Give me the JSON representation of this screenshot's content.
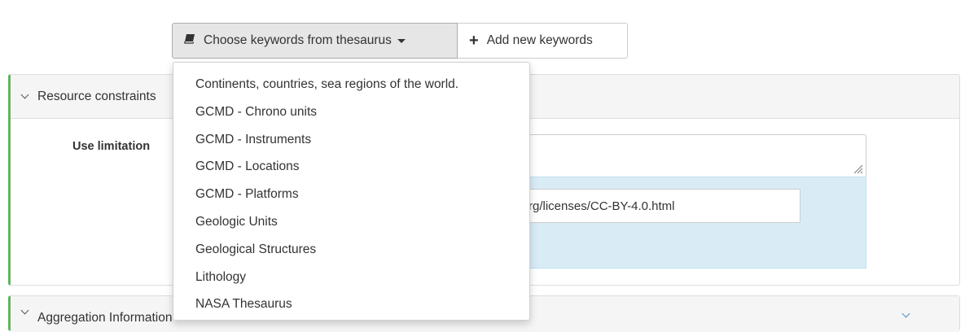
{
  "toolbar": {
    "thesaurus_button": "Choose keywords from thesaurus",
    "add_button": "Add new keywords"
  },
  "dropdown": {
    "items": [
      "Continents, countries, sea regions of the world.",
      "GCMD - Chrono units",
      "GCMD - Instruments",
      "GCMD - Locations",
      "GCMD - Platforms",
      "Geologic Units",
      "Geological Structures",
      "Lithology",
      "NASA Thesaurus"
    ]
  },
  "panels": {
    "resource_constraints": {
      "title": "Resource constraints",
      "use_limitation_label": "Use limitation",
      "license_url": "rg/licenses/CC-BY-4.0.html"
    },
    "aggregation": {
      "title": "Aggregation Information"
    }
  },
  "icons": {
    "book": "book-icon",
    "plus": "plus-icon",
    "chevron": "chevron-down-icon"
  },
  "colors": {
    "panel_accent": "#5cb85c",
    "info_bg": "#d9ecf6",
    "chevron_blue": "#4a90c8"
  }
}
